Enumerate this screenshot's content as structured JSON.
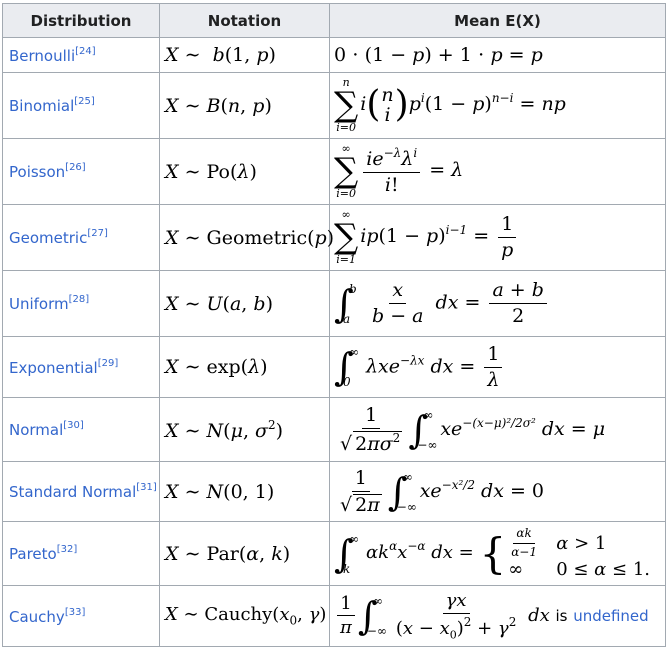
{
  "headers": [
    "Distribution",
    "Notation",
    "Mean E(X)"
  ],
  "rows": [
    {
      "name": "Bernoulli",
      "ref": "[24]"
    },
    {
      "name": "Binomial",
      "ref": "[25]"
    },
    {
      "name": "Poisson",
      "ref": "[26]"
    },
    {
      "name": "Geometric",
      "ref": "[27]"
    },
    {
      "name": "Uniform",
      "ref": "[28]"
    },
    {
      "name": "Exponential",
      "ref": "[29]"
    },
    {
      "name": "Normal",
      "ref": "[30]"
    },
    {
      "name": "Standard Normal",
      "ref": "[31]"
    },
    {
      "name": "Pareto",
      "ref": "[32]"
    },
    {
      "name": "Cauchy",
      "ref": "[33]"
    }
  ],
  "cauchy_suffix": {
    "is": "is",
    "undefined": "undefined"
  }
}
